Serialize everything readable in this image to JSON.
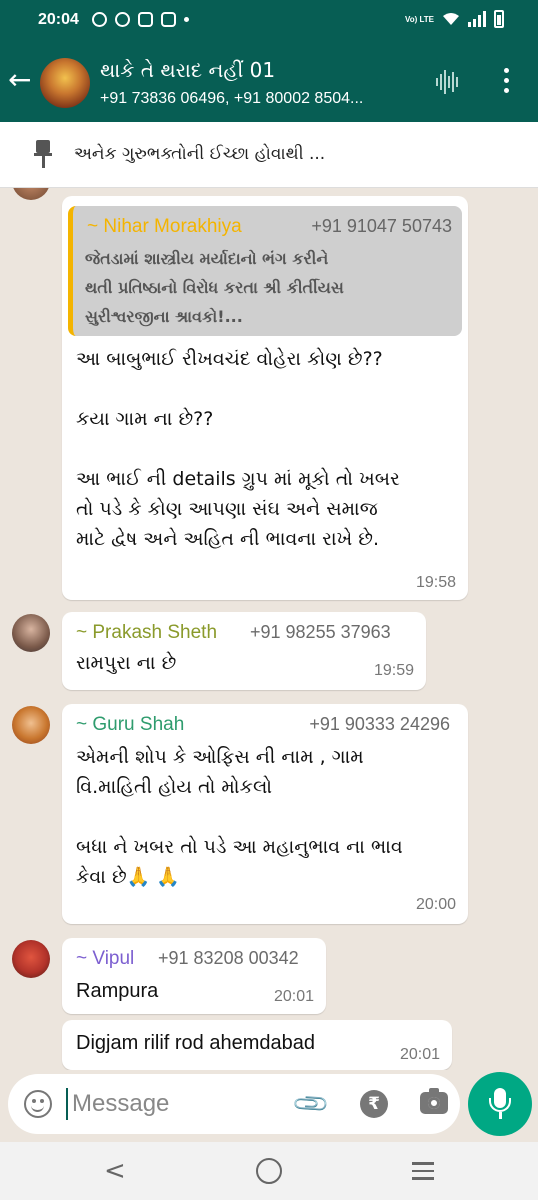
{
  "status_bar": {
    "time": "20:04",
    "network_label": "Vo) LTE"
  },
  "header": {
    "title": "થાકે તે થરાદ નહીં 01",
    "subtitle": "+91 73836 06496, +91 80002 8504..."
  },
  "pinned": {
    "text": "અનેક ગુરુભક્તોની ઈચ્છા હોવાથી ..."
  },
  "messages": [
    {
      "quote": {
        "sender": "~ Nihar Morakhiya",
        "phone": "+91 91047 50743",
        "lines": [
          "જેતડામાં શાસ્ત્રીય મર્યાદાનો ભંગ કરીને",
          "થતી પ્રતિષ્ઠાનો વિરોધ કરતા શ્રી કીર્તીયસ",
          "સુરીશ્વરજીના શ્રાવકો!..."
        ]
      },
      "lines": [
        "આ બાબુભાઈ રીખવચંદ વોહેરા કોણ છે??",
        "",
        "કયા ગામ ના છે??",
        "",
        "આ ભાઈ ની details ગ્રુપ માં મૂકો તો ખબર",
        "તો પડે કે કોણ આપણા સંઘ અને સમાજ",
        "માટે દ્વેષ અને અહિત ની ભાવના રાખે છે."
      ],
      "time": "19:58"
    },
    {
      "sender": "~ Prakash Sheth",
      "phone": "+91 98255 37963",
      "lines": [
        "રામપુરા ના છે"
      ],
      "time": "19:59"
    },
    {
      "sender": "~ Guru Shah",
      "phone": "+91 90333 24296",
      "lines": [
        "એમની શોપ કે ઓફિસ ની નામ , ગામ",
        "વિ.માહિતી હોય તો મોકલો",
        "",
        "બધા ને ખબર તો પડે આ મહાનુભાવ ના ભાવ",
        "કેવા છે🙏 🙏"
      ],
      "time": "20:00"
    },
    {
      "sender": "~ Vipul",
      "phone": "+91 83208 00342",
      "lines": [
        "Rampura"
      ],
      "time": "20:01"
    },
    {
      "lines": [
        "Digjam rilif rod ahemdabad"
      ],
      "time": "20:01"
    }
  ],
  "composer": {
    "placeholder": "Message",
    "rupee_symbol": "₹"
  },
  "colors": {
    "header_bg": "#075e54",
    "chat_bg": "#ece5dd",
    "accent": "#00a884",
    "prakash_name": "#8a9a2b",
    "guru_name": "#2f9c6e",
    "vipul_name": "#7c5fd0",
    "quote_name": "#f4b400"
  },
  "icons": [
    "back-arrow-icon",
    "voice-chat-icon",
    "more-vert-icon",
    "pin-icon",
    "emoji-icon",
    "attach-icon",
    "rupee-icon",
    "camera-icon",
    "mic-icon",
    "nav-back-icon",
    "nav-home-icon",
    "nav-recents-icon"
  ]
}
